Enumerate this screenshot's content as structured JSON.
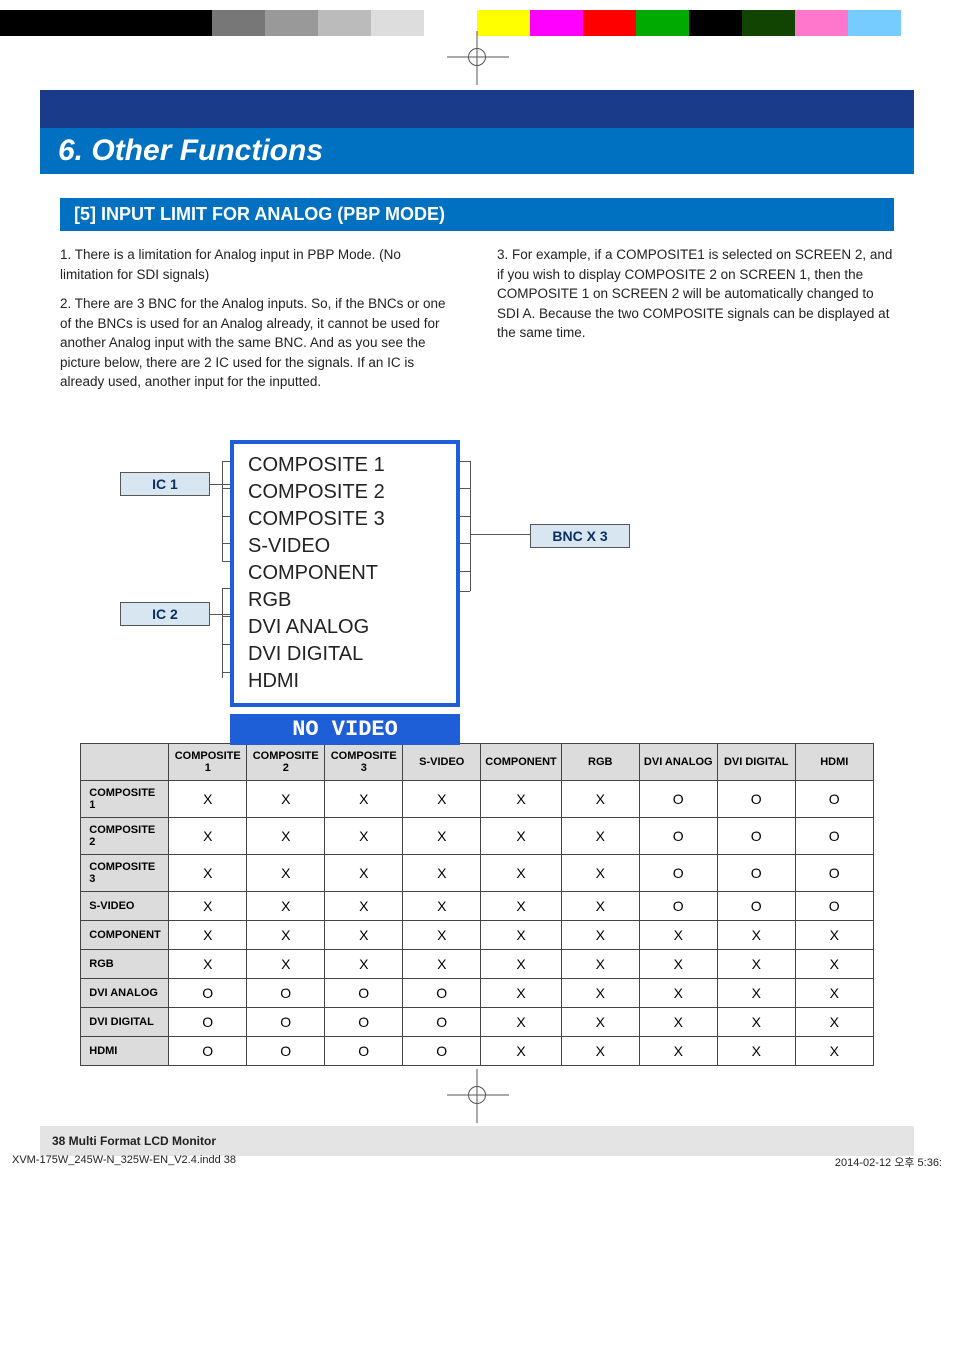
{
  "colorbar": [
    "#000",
    "#000",
    "#000",
    "#000",
    "#777",
    "#999",
    "#bbb",
    "#ddd",
    "#fff",
    "#ff0",
    "#f0f",
    "#f00",
    "#0a0",
    "#000",
    "#140",
    "#f7c",
    "#7cf",
    "#fff"
  ],
  "chapter": "6. Other Functions",
  "section": "[5] INPUT LIMIT FOR ANALOG (PBP MODE)",
  "left_paras": [
    "1. There is a limitation for Analog input in PBP Mode. (No limitation for SDI signals)",
    "2. There are 3 BNC for the Analog inputs. So, if the BNCs or one of the BNCs is used for an Analog already, it cannot be used for another Analog input with the same BNC. And as you see the picture below, there are 2 IC used for the signals. If an IC is already used, another input for the inputted."
  ],
  "right_paras": [
    "3. For example, if a COMPOSITE1 is selected on SCREEN 2, and if you wish to display COMPOSITE 2 on SCREEN 1, then the COMPOSITE 1 on SCREEN 2 will be automatically changed to SDI A. Because the two COMPOSITE signals can be displayed at the same time."
  ],
  "diagram": {
    "ic1": "IC 1",
    "ic2": "IC 2",
    "bnc": "BNC X 3",
    "no_video": "NO VIDEO",
    "signals": [
      "COMPOSITE 1",
      "COMPOSITE 2",
      "COMPOSITE 3",
      "S-VIDEO",
      "COMPONENT",
      "RGB",
      "DVI ANALOG",
      "DVI DIGITAL",
      "HDMI"
    ]
  },
  "table": {
    "cols": [
      "COMPOSITE 1",
      "COMPOSITE 2",
      "COMPOSITE 3",
      "S-VIDEO",
      "COMPONENT",
      "RGB",
      "DVI ANALOG",
      "DVI DIGITAL",
      "HDMI"
    ],
    "rows": [
      {
        "h": "COMPOSITE 1",
        "v": [
          "X",
          "X",
          "X",
          "X",
          "X",
          "X",
          "O",
          "O",
          "O"
        ]
      },
      {
        "h": "COMPOSITE 2",
        "v": [
          "X",
          "X",
          "X",
          "X",
          "X",
          "X",
          "O",
          "O",
          "O"
        ]
      },
      {
        "h": "COMPOSITE 3",
        "v": [
          "X",
          "X",
          "X",
          "X",
          "X",
          "X",
          "O",
          "O",
          "O"
        ]
      },
      {
        "h": "S-VIDEO",
        "v": [
          "X",
          "X",
          "X",
          "X",
          "X",
          "X",
          "O",
          "O",
          "O"
        ]
      },
      {
        "h": "COMPONENT",
        "v": [
          "X",
          "X",
          "X",
          "X",
          "X",
          "X",
          "X",
          "X",
          "X"
        ]
      },
      {
        "h": "RGB",
        "v": [
          "X",
          "X",
          "X",
          "X",
          "X",
          "X",
          "X",
          "X",
          "X"
        ]
      },
      {
        "h": "DVI ANALOG",
        "v": [
          "O",
          "O",
          "O",
          "O",
          "X",
          "X",
          "X",
          "X",
          "X"
        ]
      },
      {
        "h": "DVI DIGITAL",
        "v": [
          "O",
          "O",
          "O",
          "O",
          "X",
          "X",
          "X",
          "X",
          "X"
        ]
      },
      {
        "h": "HDMI",
        "v": [
          "O",
          "O",
          "O",
          "O",
          "X",
          "X",
          "X",
          "X",
          "X"
        ]
      }
    ]
  },
  "footer": "38  Multi Format LCD Monitor",
  "print_left": "XVM-175W_245W-N_325W-EN_V2.4.indd   38",
  "print_right": "2014-02-12   오후 5:36:"
}
